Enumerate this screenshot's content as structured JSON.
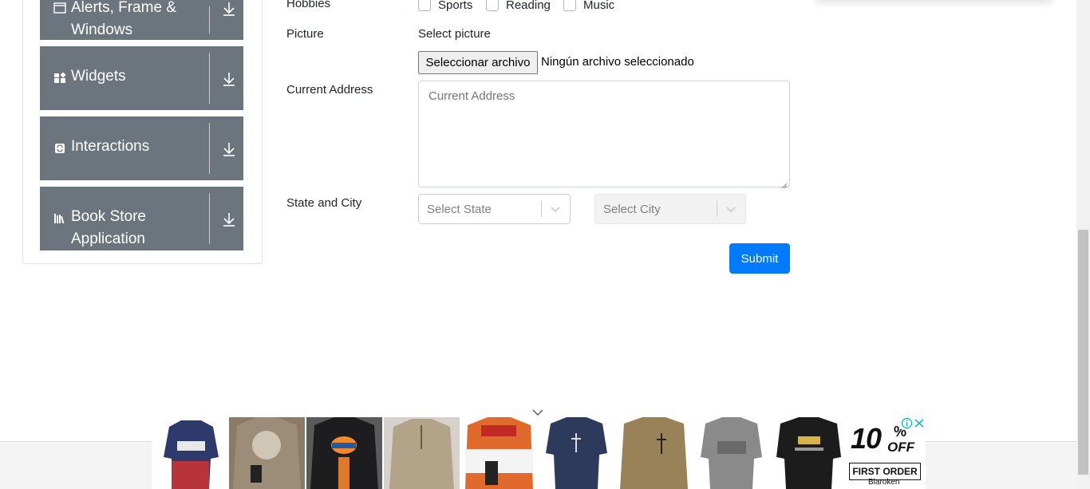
{
  "sidebar": {
    "groups": [
      {
        "label_line1": "Alerts, Frame &",
        "label_line2": "Windows",
        "icon": "window-icon"
      },
      {
        "label": "Widgets",
        "icon": "widgets-grid-icon"
      },
      {
        "label": "Interactions",
        "icon": "refresh-icon"
      },
      {
        "label_line1": "Book Store",
        "label_line2": "Application",
        "icon": "books-icon"
      }
    ]
  },
  "form": {
    "hobbies_label": "Hobbies",
    "hobbies": [
      "Sports",
      "Reading",
      "Music"
    ],
    "picture_label": "Picture",
    "select_picture": "Select picture",
    "file_button": "Seleccionar archivo",
    "file_status": "Ningún archivo seleccionado",
    "address_label": "Current Address",
    "address_placeholder": "Current Address",
    "state_city_label": "State and City",
    "state_placeholder": "Select State",
    "city_placeholder": "Select City",
    "submit": "Submit"
  },
  "ad": {
    "promo_percent": "10",
    "promo_pct_sign": "%",
    "promo_off": "OFF",
    "promo_first": "FIRST ORDER",
    "promo_brand": "Blaroken",
    "tile_colors": [
      "#a33a3a",
      "#7a6a58",
      "#2b2b2b",
      "#b5a58c",
      "#d9652a",
      "#2c3755",
      "#8a7350",
      "#7d7d7d",
      "#1e1e1e"
    ]
  },
  "colors": {
    "sidebar_bg": "#6c757d",
    "primary": "#007bff"
  }
}
